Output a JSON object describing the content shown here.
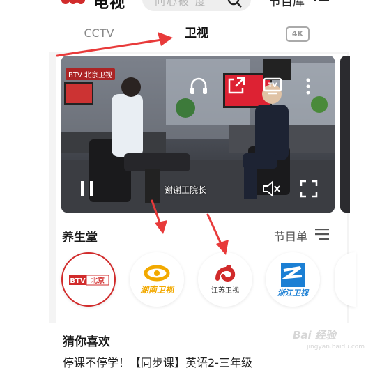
{
  "header": {
    "app_title": "电视",
    "search_placeholder": "问心破  度",
    "program_library_label": "节目库",
    "logo_icon": "cctv-logo-icon",
    "search_icon": "search-icon",
    "menu_icon": "menu-icon"
  },
  "tabs": [
    {
      "label": "CCTV",
      "active": false
    },
    {
      "label": "卫视",
      "active": true
    },
    {
      "label": "4K",
      "active": false
    }
  ],
  "video": {
    "channel_badge": "BTV 北京卫视",
    "caption": "谢谢王院长",
    "controls": [
      "listen-icon",
      "share-icon",
      "cast-tv-icon",
      "more-vert-icon",
      "pause-icon",
      "mute-icon",
      "fullscreen-icon"
    ]
  },
  "section": {
    "title": "养生堂",
    "schedule_label": "节目单"
  },
  "channels": [
    {
      "name": "BTV北京",
      "color": "#d12b2b"
    },
    {
      "name": "湖南卫视",
      "color": "#f2a900"
    },
    {
      "name": "江苏卫视",
      "color": "#d12b2b"
    },
    {
      "name": "浙江卫视",
      "color": "#1b7fd4"
    }
  ],
  "guess": {
    "title": "猜你喜欢",
    "item_title": "停课不停学！【同步课】英语2-三年级"
  },
  "watermark": {
    "text": "Bai 经验",
    "sub": "jingyan.baidu.com"
  },
  "colors": {
    "accent": "#d12b2b",
    "arrow": "#e83a3a"
  }
}
